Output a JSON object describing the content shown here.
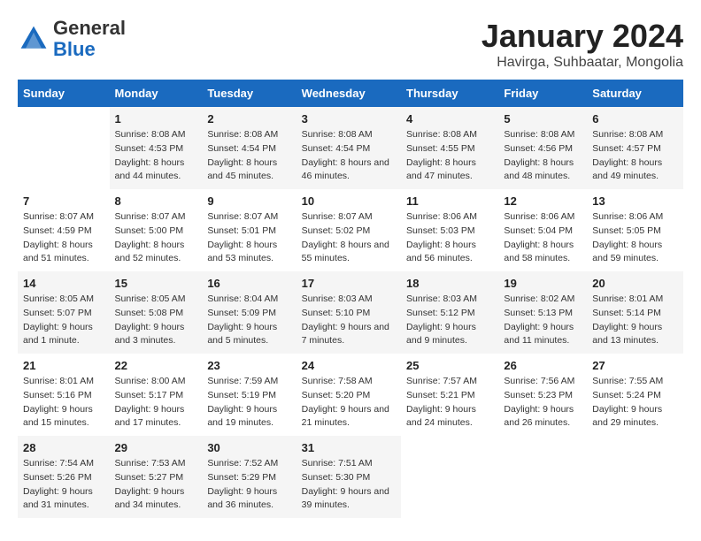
{
  "logo": {
    "general": "General",
    "blue": "Blue"
  },
  "title": "January 2024",
  "location": "Havirga, Suhbaatar, Mongolia",
  "days_of_week": [
    "Sunday",
    "Monday",
    "Tuesday",
    "Wednesday",
    "Thursday",
    "Friday",
    "Saturday"
  ],
  "weeks": [
    [
      {
        "num": "",
        "sunrise": "",
        "sunset": "",
        "daylight": ""
      },
      {
        "num": "1",
        "sunrise": "Sunrise: 8:08 AM",
        "sunset": "Sunset: 4:53 PM",
        "daylight": "Daylight: 8 hours and 44 minutes."
      },
      {
        "num": "2",
        "sunrise": "Sunrise: 8:08 AM",
        "sunset": "Sunset: 4:54 PM",
        "daylight": "Daylight: 8 hours and 45 minutes."
      },
      {
        "num": "3",
        "sunrise": "Sunrise: 8:08 AM",
        "sunset": "Sunset: 4:54 PM",
        "daylight": "Daylight: 8 hours and 46 minutes."
      },
      {
        "num": "4",
        "sunrise": "Sunrise: 8:08 AM",
        "sunset": "Sunset: 4:55 PM",
        "daylight": "Daylight: 8 hours and 47 minutes."
      },
      {
        "num": "5",
        "sunrise": "Sunrise: 8:08 AM",
        "sunset": "Sunset: 4:56 PM",
        "daylight": "Daylight: 8 hours and 48 minutes."
      },
      {
        "num": "6",
        "sunrise": "Sunrise: 8:08 AM",
        "sunset": "Sunset: 4:57 PM",
        "daylight": "Daylight: 8 hours and 49 minutes."
      }
    ],
    [
      {
        "num": "7",
        "sunrise": "Sunrise: 8:07 AM",
        "sunset": "Sunset: 4:59 PM",
        "daylight": "Daylight: 8 hours and 51 minutes."
      },
      {
        "num": "8",
        "sunrise": "Sunrise: 8:07 AM",
        "sunset": "Sunset: 5:00 PM",
        "daylight": "Daylight: 8 hours and 52 minutes."
      },
      {
        "num": "9",
        "sunrise": "Sunrise: 8:07 AM",
        "sunset": "Sunset: 5:01 PM",
        "daylight": "Daylight: 8 hours and 53 minutes."
      },
      {
        "num": "10",
        "sunrise": "Sunrise: 8:07 AM",
        "sunset": "Sunset: 5:02 PM",
        "daylight": "Daylight: 8 hours and 55 minutes."
      },
      {
        "num": "11",
        "sunrise": "Sunrise: 8:06 AM",
        "sunset": "Sunset: 5:03 PM",
        "daylight": "Daylight: 8 hours and 56 minutes."
      },
      {
        "num": "12",
        "sunrise": "Sunrise: 8:06 AM",
        "sunset": "Sunset: 5:04 PM",
        "daylight": "Daylight: 8 hours and 58 minutes."
      },
      {
        "num": "13",
        "sunrise": "Sunrise: 8:06 AM",
        "sunset": "Sunset: 5:05 PM",
        "daylight": "Daylight: 8 hours and 59 minutes."
      }
    ],
    [
      {
        "num": "14",
        "sunrise": "Sunrise: 8:05 AM",
        "sunset": "Sunset: 5:07 PM",
        "daylight": "Daylight: 9 hours and 1 minute."
      },
      {
        "num": "15",
        "sunrise": "Sunrise: 8:05 AM",
        "sunset": "Sunset: 5:08 PM",
        "daylight": "Daylight: 9 hours and 3 minutes."
      },
      {
        "num": "16",
        "sunrise": "Sunrise: 8:04 AM",
        "sunset": "Sunset: 5:09 PM",
        "daylight": "Daylight: 9 hours and 5 minutes."
      },
      {
        "num": "17",
        "sunrise": "Sunrise: 8:03 AM",
        "sunset": "Sunset: 5:10 PM",
        "daylight": "Daylight: 9 hours and 7 minutes."
      },
      {
        "num": "18",
        "sunrise": "Sunrise: 8:03 AM",
        "sunset": "Sunset: 5:12 PM",
        "daylight": "Daylight: 9 hours and 9 minutes."
      },
      {
        "num": "19",
        "sunrise": "Sunrise: 8:02 AM",
        "sunset": "Sunset: 5:13 PM",
        "daylight": "Daylight: 9 hours and 11 minutes."
      },
      {
        "num": "20",
        "sunrise": "Sunrise: 8:01 AM",
        "sunset": "Sunset: 5:14 PM",
        "daylight": "Daylight: 9 hours and 13 minutes."
      }
    ],
    [
      {
        "num": "21",
        "sunrise": "Sunrise: 8:01 AM",
        "sunset": "Sunset: 5:16 PM",
        "daylight": "Daylight: 9 hours and 15 minutes."
      },
      {
        "num": "22",
        "sunrise": "Sunrise: 8:00 AM",
        "sunset": "Sunset: 5:17 PM",
        "daylight": "Daylight: 9 hours and 17 minutes."
      },
      {
        "num": "23",
        "sunrise": "Sunrise: 7:59 AM",
        "sunset": "Sunset: 5:19 PM",
        "daylight": "Daylight: 9 hours and 19 minutes."
      },
      {
        "num": "24",
        "sunrise": "Sunrise: 7:58 AM",
        "sunset": "Sunset: 5:20 PM",
        "daylight": "Daylight: 9 hours and 21 minutes."
      },
      {
        "num": "25",
        "sunrise": "Sunrise: 7:57 AM",
        "sunset": "Sunset: 5:21 PM",
        "daylight": "Daylight: 9 hours and 24 minutes."
      },
      {
        "num": "26",
        "sunrise": "Sunrise: 7:56 AM",
        "sunset": "Sunset: 5:23 PM",
        "daylight": "Daylight: 9 hours and 26 minutes."
      },
      {
        "num": "27",
        "sunrise": "Sunrise: 7:55 AM",
        "sunset": "Sunset: 5:24 PM",
        "daylight": "Daylight: 9 hours and 29 minutes."
      }
    ],
    [
      {
        "num": "28",
        "sunrise": "Sunrise: 7:54 AM",
        "sunset": "Sunset: 5:26 PM",
        "daylight": "Daylight: 9 hours and 31 minutes."
      },
      {
        "num": "29",
        "sunrise": "Sunrise: 7:53 AM",
        "sunset": "Sunset: 5:27 PM",
        "daylight": "Daylight: 9 hours and 34 minutes."
      },
      {
        "num": "30",
        "sunrise": "Sunrise: 7:52 AM",
        "sunset": "Sunset: 5:29 PM",
        "daylight": "Daylight: 9 hours and 36 minutes."
      },
      {
        "num": "31",
        "sunrise": "Sunrise: 7:51 AM",
        "sunset": "Sunset: 5:30 PM",
        "daylight": "Daylight: 9 hours and 39 minutes."
      },
      {
        "num": "",
        "sunrise": "",
        "sunset": "",
        "daylight": ""
      },
      {
        "num": "",
        "sunrise": "",
        "sunset": "",
        "daylight": ""
      },
      {
        "num": "",
        "sunrise": "",
        "sunset": "",
        "daylight": ""
      }
    ]
  ]
}
